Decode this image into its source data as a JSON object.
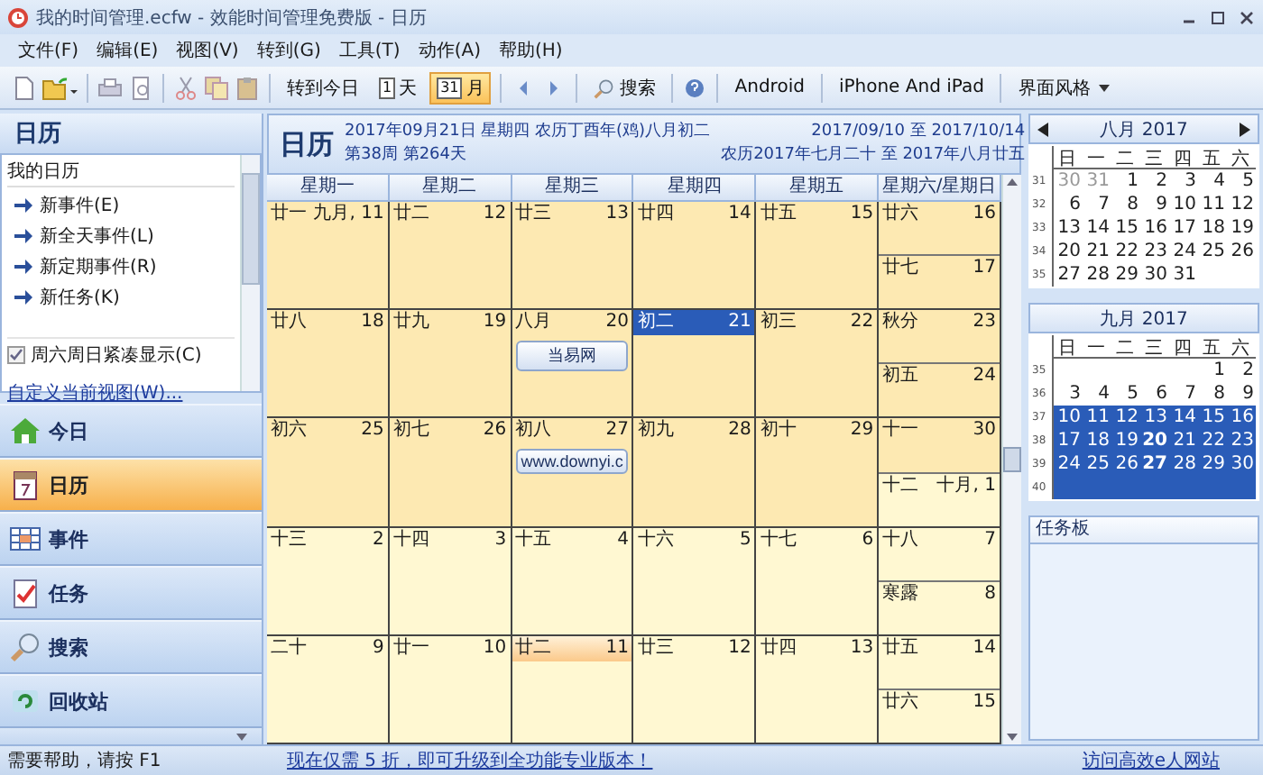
{
  "window": {
    "title": "我的时间管理.ecfw - 效能时间管理免费版 - 日历"
  },
  "menu": [
    "文件(F)",
    "编辑(E)",
    "视图(V)",
    "转到(G)",
    "工具(T)",
    "动作(A)",
    "帮助(H)"
  ],
  "toolbar": [
    {
      "kind": "icon"
    },
    {
      "kind": "icon"
    },
    {
      "kind": "sep"
    },
    {
      "kind": "icon"
    },
    {
      "kind": "icon"
    },
    {
      "kind": "sep"
    },
    {
      "kind": "icon"
    },
    {
      "kind": "icon"
    },
    {
      "kind": "icon"
    },
    {
      "kind": "sep"
    },
    {
      "kind": "text",
      "label": "转到今日",
      "selected": false
    },
    {
      "kind": "text",
      "badge": "1",
      "label": "天",
      "selected": false
    },
    {
      "kind": "text",
      "badge": "31",
      "label": "月",
      "selected": true
    },
    {
      "kind": "sep"
    },
    {
      "kind": "icon"
    },
    {
      "kind": "icon"
    },
    {
      "kind": "sep"
    },
    {
      "kind": "text",
      "search": true,
      "label": "搜索",
      "selected": false
    },
    {
      "kind": "sep"
    },
    {
      "kind": "icon"
    },
    {
      "kind": "sep"
    },
    {
      "kind": "text",
      "label": "Android",
      "selected": false
    },
    {
      "kind": "sep"
    },
    {
      "kind": "text",
      "label": "iPhone And iPad",
      "selected": false
    },
    {
      "kind": "sep"
    },
    {
      "kind": "text",
      "label": "界面风格",
      "dropdown": true,
      "selected": false
    }
  ],
  "sidebar": {
    "title": "日历",
    "list_title": "我的日历",
    "actions": [
      "新事件(E)",
      "新全天事件(L)",
      "新定期事件(R)",
      "新任务(K)"
    ],
    "option": {
      "label": "周六周日紧凑显示(C)",
      "checked": true
    },
    "link": "自定义当前视图(W)...",
    "nav": [
      {
        "label": "今日",
        "kind": "home",
        "selected": false
      },
      {
        "label": "日历",
        "kind": "calendar",
        "selected": true
      },
      {
        "label": "事件",
        "kind": "events",
        "selected": false
      },
      {
        "label": "任务",
        "kind": "tasks",
        "selected": false
      },
      {
        "label": "搜索",
        "kind": "search",
        "selected": false
      },
      {
        "label": "回收站",
        "kind": "recycle",
        "selected": false
      }
    ]
  },
  "main": {
    "title": "日历",
    "date": "2017年09月21日 星期四 农历丁酉年(鸡)八月初二",
    "week_info": "第38周 第264天",
    "range": "2017/09/10 至 2017/10/14",
    "lunar_range": "农历2017年七月二十 至 2017年八月廿五",
    "columns": [
      "星期一",
      "星期二",
      "星期三",
      "星期四",
      "星期五",
      "星期六/星期日"
    ],
    "weeks": [
      {
        "days": [
          {
            "lunar": "廿一",
            "day": "九月, 11",
            "in_month": true,
            "selected": false,
            "today": false
          },
          {
            "lunar": "廿二",
            "day": "12",
            "in_month": true,
            "selected": false,
            "today": false
          },
          {
            "lunar": "廿三",
            "day": "13",
            "in_month": true,
            "selected": false,
            "today": false
          },
          {
            "lunar": "廿四",
            "day": "14",
            "in_month": true,
            "selected": false,
            "today": false
          },
          {
            "lunar": "廿五",
            "day": "15",
            "in_month": true,
            "selected": false,
            "today": false
          },
          {
            "lunar": "廿六",
            "day": "16",
            "in_month": true,
            "selected": false,
            "today": false
          },
          {
            "lunar": "廿七",
            "day": "17",
            "in_month": true,
            "selected": false,
            "today": false
          }
        ]
      },
      {
        "days": [
          {
            "lunar": "廿八",
            "day": "18",
            "in_month": true,
            "selected": false,
            "today": false
          },
          {
            "lunar": "廿九",
            "day": "19",
            "in_month": true,
            "selected": false,
            "today": false
          },
          {
            "lunar": "八月",
            "day": "20",
            "in_month": true,
            "selected": false,
            "today": false,
            "events": [
              "当易网"
            ]
          },
          {
            "lunar": "初二",
            "day": "21",
            "in_month": true,
            "selected": true,
            "today": false
          },
          {
            "lunar": "初三",
            "day": "22",
            "in_month": true,
            "selected": false,
            "today": false
          },
          {
            "lunar": "秋分",
            "day": "23",
            "in_month": true,
            "selected": false,
            "today": false
          },
          {
            "lunar": "初五",
            "day": "24",
            "in_month": true,
            "selected": false,
            "today": false
          }
        ]
      },
      {
        "days": [
          {
            "lunar": "初六",
            "day": "25",
            "in_month": true,
            "selected": false,
            "today": false
          },
          {
            "lunar": "初七",
            "day": "26",
            "in_month": true,
            "selected": false,
            "today": false
          },
          {
            "lunar": "初八",
            "day": "27",
            "in_month": true,
            "selected": false,
            "today": false,
            "events": [
              "www.downyi.c"
            ]
          },
          {
            "lunar": "初九",
            "day": "28",
            "in_month": true,
            "selected": false,
            "today": false
          },
          {
            "lunar": "初十",
            "day": "29",
            "in_month": true,
            "selected": false,
            "today": false
          },
          {
            "lunar": "十一",
            "day": "30",
            "in_month": true,
            "selected": false,
            "today": false
          },
          {
            "lunar": "十二",
            "day": "十月, 1",
            "in_month": false,
            "selected": false,
            "today": false
          }
        ]
      },
      {
        "days": [
          {
            "lunar": "十三",
            "day": "2",
            "in_month": false,
            "selected": false,
            "today": false
          },
          {
            "lunar": "十四",
            "day": "3",
            "in_month": false,
            "selected": false,
            "today": false
          },
          {
            "lunar": "十五",
            "day": "4",
            "in_month": false,
            "selected": false,
            "today": false
          },
          {
            "lunar": "十六",
            "day": "5",
            "in_month": false,
            "selected": false,
            "today": false
          },
          {
            "lunar": "十七",
            "day": "6",
            "in_month": false,
            "selected": false,
            "today": false
          },
          {
            "lunar": "十八",
            "day": "7",
            "in_month": false,
            "selected": false,
            "today": false
          },
          {
            "lunar": "寒露",
            "day": "8",
            "in_month": false,
            "selected": false,
            "today": false
          }
        ]
      },
      {
        "days": [
          {
            "lunar": "二十",
            "day": "9",
            "in_month": false,
            "selected": false,
            "today": false
          },
          {
            "lunar": "廿一",
            "day": "10",
            "in_month": false,
            "selected": false,
            "today": false
          },
          {
            "lunar": "廿二",
            "day": "11",
            "in_month": false,
            "selected": false,
            "today": true
          },
          {
            "lunar": "廿三",
            "day": "12",
            "in_month": false,
            "selected": false,
            "today": false
          },
          {
            "lunar": "廿四",
            "day": "13",
            "in_month": false,
            "selected": false,
            "today": false
          },
          {
            "lunar": "廿五",
            "day": "14",
            "in_month": false,
            "selected": false,
            "today": false
          },
          {
            "lunar": "廿六",
            "day": "15",
            "in_month": false,
            "selected": false,
            "today": false
          }
        ]
      }
    ]
  },
  "mini_calendars": [
    {
      "title": "八月 2017",
      "arrows": true,
      "weekdays": [
        "日",
        "一",
        "二",
        "三",
        "四",
        "五",
        "六"
      ],
      "weeks": [
        {
          "week": "31",
          "selected": false,
          "days": [
            {
              "d": "30",
              "dim": true,
              "bold": false
            },
            {
              "d": "31",
              "dim": true,
              "bold": false
            },
            {
              "d": "1",
              "dim": false,
              "bold": false
            },
            {
              "d": "2",
              "dim": false,
              "bold": false
            },
            {
              "d": "3",
              "dim": false,
              "bold": false
            },
            {
              "d": "4",
              "dim": false,
              "bold": false
            },
            {
              "d": "5",
              "dim": false,
              "bold": false
            }
          ]
        },
        {
          "week": "32",
          "selected": false,
          "days": [
            {
              "d": "6",
              "dim": false,
              "bold": false
            },
            {
              "d": "7",
              "dim": false,
              "bold": false
            },
            {
              "d": "8",
              "dim": false,
              "bold": false
            },
            {
              "d": "9",
              "dim": false,
              "bold": false
            },
            {
              "d": "10",
              "dim": false,
              "bold": false
            },
            {
              "d": "11",
              "dim": false,
              "bold": false
            },
            {
              "d": "12",
              "dim": false,
              "bold": false
            }
          ]
        },
        {
          "week": "33",
          "selected": false,
          "days": [
            {
              "d": "13",
              "dim": false,
              "bold": false
            },
            {
              "d": "14",
              "dim": false,
              "bold": false
            },
            {
              "d": "15",
              "dim": false,
              "bold": false
            },
            {
              "d": "16",
              "dim": false,
              "bold": false
            },
            {
              "d": "17",
              "dim": false,
              "bold": false
            },
            {
              "d": "18",
              "dim": false,
              "bold": false
            },
            {
              "d": "19",
              "dim": false,
              "bold": false
            }
          ]
        },
        {
          "week": "34",
          "selected": false,
          "days": [
            {
              "d": "20",
              "dim": false,
              "bold": false
            },
            {
              "d": "21",
              "dim": false,
              "bold": false
            },
            {
              "d": "22",
              "dim": false,
              "bold": false
            },
            {
              "d": "23",
              "dim": false,
              "bold": false
            },
            {
              "d": "24",
              "dim": false,
              "bold": false
            },
            {
              "d": "25",
              "dim": false,
              "bold": false
            },
            {
              "d": "26",
              "dim": false,
              "bold": false
            }
          ]
        },
        {
          "week": "35",
          "selected": false,
          "days": [
            {
              "d": "27",
              "dim": false,
              "bold": false
            },
            {
              "d": "28",
              "dim": false,
              "bold": false
            },
            {
              "d": "29",
              "dim": false,
              "bold": false
            },
            {
              "d": "30",
              "dim": false,
              "bold": false
            },
            {
              "d": "31",
              "dim": false,
              "bold": false
            }
          ]
        }
      ]
    },
    {
      "title": "九月 2017",
      "arrows": false,
      "weekdays": [
        "日",
        "一",
        "二",
        "三",
        "四",
        "五",
        "六"
      ],
      "weeks": [
        {
          "week": "35",
          "selected": false,
          "days": [
            {
              "d": "1",
              "dim": false,
              "bold": false
            },
            {
              "d": "2",
              "dim": false,
              "bold": false
            }
          ]
        },
        {
          "week": "36",
          "selected": false,
          "days": [
            {
              "d": "3",
              "dim": false,
              "bold": false
            },
            {
              "d": "4",
              "dim": false,
              "bold": false
            },
            {
              "d": "5",
              "dim": false,
              "bold": false
            },
            {
              "d": "6",
              "dim": false,
              "bold": false
            },
            {
              "d": "7",
              "dim": false,
              "bold": false
            },
            {
              "d": "8",
              "dim": false,
              "bold": false
            },
            {
              "d": "9",
              "dim": false,
              "bold": false
            }
          ]
        },
        {
          "week": "37",
          "selected": true,
          "days": [
            {
              "d": "10",
              "dim": false,
              "bold": false
            },
            {
              "d": "11",
              "dim": false,
              "bold": false
            },
            {
              "d": "12",
              "dim": false,
              "bold": false
            },
            {
              "d": "13",
              "dim": false,
              "bold": false
            },
            {
              "d": "14",
              "dim": false,
              "bold": false
            },
            {
              "d": "15",
              "dim": false,
              "bold": false
            },
            {
              "d": "16",
              "dim": false,
              "bold": false
            }
          ]
        },
        {
          "week": "38",
          "selected": true,
          "days": [
            {
              "d": "17",
              "dim": false,
              "bold": false
            },
            {
              "d": "18",
              "dim": false,
              "bold": false
            },
            {
              "d": "19",
              "dim": false,
              "bold": false
            },
            {
              "d": "20",
              "dim": false,
              "bold": true
            },
            {
              "d": "21",
              "dim": false,
              "bold": false
            },
            {
              "d": "22",
              "dim": false,
              "bold": false
            },
            {
              "d": "23",
              "dim": false,
              "bold": false
            }
          ]
        },
        {
          "week": "39",
          "selected": true,
          "days": [
            {
              "d": "24",
              "dim": false,
              "bold": false
            },
            {
              "d": "25",
              "dim": false,
              "bold": false
            },
            {
              "d": "26",
              "dim": false,
              "bold": false
            },
            {
              "d": "27",
              "dim": false,
              "bold": true
            },
            {
              "d": "28",
              "dim": false,
              "bold": false
            },
            {
              "d": "29",
              "dim": false,
              "bold": false
            },
            {
              "d": "30",
              "dim": false,
              "bold": false
            }
          ]
        },
        {
          "week": "40",
          "selected": true
        }
      ]
    }
  ],
  "task_board": {
    "title": "任务板"
  },
  "status_bar": {
    "help": "需要帮助，请按 F1",
    "promo": "现在仅需 5 折，即可升级到全功能专业版本！",
    "site": "访问高效e人网站"
  }
}
